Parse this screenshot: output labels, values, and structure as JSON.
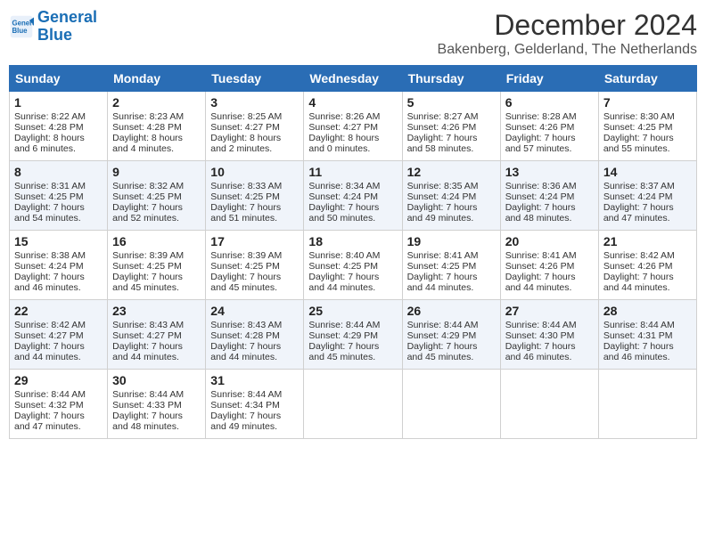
{
  "header": {
    "logo_line1": "General",
    "logo_line2": "Blue",
    "month": "December 2024",
    "location": "Bakenberg, Gelderland, The Netherlands"
  },
  "weekdays": [
    "Sunday",
    "Monday",
    "Tuesday",
    "Wednesday",
    "Thursday",
    "Friday",
    "Saturday"
  ],
  "weeks": [
    [
      {
        "day": "1",
        "sunrise": "Sunrise: 8:22 AM",
        "sunset": "Sunset: 4:28 PM",
        "daylight": "Daylight: 8 hours and 6 minutes."
      },
      {
        "day": "2",
        "sunrise": "Sunrise: 8:23 AM",
        "sunset": "Sunset: 4:28 PM",
        "daylight": "Daylight: 8 hours and 4 minutes."
      },
      {
        "day": "3",
        "sunrise": "Sunrise: 8:25 AM",
        "sunset": "Sunset: 4:27 PM",
        "daylight": "Daylight: 8 hours and 2 minutes."
      },
      {
        "day": "4",
        "sunrise": "Sunrise: 8:26 AM",
        "sunset": "Sunset: 4:27 PM",
        "daylight": "Daylight: 8 hours and 0 minutes."
      },
      {
        "day": "5",
        "sunrise": "Sunrise: 8:27 AM",
        "sunset": "Sunset: 4:26 PM",
        "daylight": "Daylight: 7 hours and 58 minutes."
      },
      {
        "day": "6",
        "sunrise": "Sunrise: 8:28 AM",
        "sunset": "Sunset: 4:26 PM",
        "daylight": "Daylight: 7 hours and 57 minutes."
      },
      {
        "day": "7",
        "sunrise": "Sunrise: 8:30 AM",
        "sunset": "Sunset: 4:25 PM",
        "daylight": "Daylight: 7 hours and 55 minutes."
      }
    ],
    [
      {
        "day": "8",
        "sunrise": "Sunrise: 8:31 AM",
        "sunset": "Sunset: 4:25 PM",
        "daylight": "Daylight: 7 hours and 54 minutes."
      },
      {
        "day": "9",
        "sunrise": "Sunrise: 8:32 AM",
        "sunset": "Sunset: 4:25 PM",
        "daylight": "Daylight: 7 hours and 52 minutes."
      },
      {
        "day": "10",
        "sunrise": "Sunrise: 8:33 AM",
        "sunset": "Sunset: 4:25 PM",
        "daylight": "Daylight: 7 hours and 51 minutes."
      },
      {
        "day": "11",
        "sunrise": "Sunrise: 8:34 AM",
        "sunset": "Sunset: 4:24 PM",
        "daylight": "Daylight: 7 hours and 50 minutes."
      },
      {
        "day": "12",
        "sunrise": "Sunrise: 8:35 AM",
        "sunset": "Sunset: 4:24 PM",
        "daylight": "Daylight: 7 hours and 49 minutes."
      },
      {
        "day": "13",
        "sunrise": "Sunrise: 8:36 AM",
        "sunset": "Sunset: 4:24 PM",
        "daylight": "Daylight: 7 hours and 48 minutes."
      },
      {
        "day": "14",
        "sunrise": "Sunrise: 8:37 AM",
        "sunset": "Sunset: 4:24 PM",
        "daylight": "Daylight: 7 hours and 47 minutes."
      }
    ],
    [
      {
        "day": "15",
        "sunrise": "Sunrise: 8:38 AM",
        "sunset": "Sunset: 4:24 PM",
        "daylight": "Daylight: 7 hours and 46 minutes."
      },
      {
        "day": "16",
        "sunrise": "Sunrise: 8:39 AM",
        "sunset": "Sunset: 4:25 PM",
        "daylight": "Daylight: 7 hours and 45 minutes."
      },
      {
        "day": "17",
        "sunrise": "Sunrise: 8:39 AM",
        "sunset": "Sunset: 4:25 PM",
        "daylight": "Daylight: 7 hours and 45 minutes."
      },
      {
        "day": "18",
        "sunrise": "Sunrise: 8:40 AM",
        "sunset": "Sunset: 4:25 PM",
        "daylight": "Daylight: 7 hours and 44 minutes."
      },
      {
        "day": "19",
        "sunrise": "Sunrise: 8:41 AM",
        "sunset": "Sunset: 4:25 PM",
        "daylight": "Daylight: 7 hours and 44 minutes."
      },
      {
        "day": "20",
        "sunrise": "Sunrise: 8:41 AM",
        "sunset": "Sunset: 4:26 PM",
        "daylight": "Daylight: 7 hours and 44 minutes."
      },
      {
        "day": "21",
        "sunrise": "Sunrise: 8:42 AM",
        "sunset": "Sunset: 4:26 PM",
        "daylight": "Daylight: 7 hours and 44 minutes."
      }
    ],
    [
      {
        "day": "22",
        "sunrise": "Sunrise: 8:42 AM",
        "sunset": "Sunset: 4:27 PM",
        "daylight": "Daylight: 7 hours and 44 minutes."
      },
      {
        "day": "23",
        "sunrise": "Sunrise: 8:43 AM",
        "sunset": "Sunset: 4:27 PM",
        "daylight": "Daylight: 7 hours and 44 minutes."
      },
      {
        "day": "24",
        "sunrise": "Sunrise: 8:43 AM",
        "sunset": "Sunset: 4:28 PM",
        "daylight": "Daylight: 7 hours and 44 minutes."
      },
      {
        "day": "25",
        "sunrise": "Sunrise: 8:44 AM",
        "sunset": "Sunset: 4:29 PM",
        "daylight": "Daylight: 7 hours and 45 minutes."
      },
      {
        "day": "26",
        "sunrise": "Sunrise: 8:44 AM",
        "sunset": "Sunset: 4:29 PM",
        "daylight": "Daylight: 7 hours and 45 minutes."
      },
      {
        "day": "27",
        "sunrise": "Sunrise: 8:44 AM",
        "sunset": "Sunset: 4:30 PM",
        "daylight": "Daylight: 7 hours and 46 minutes."
      },
      {
        "day": "28",
        "sunrise": "Sunrise: 8:44 AM",
        "sunset": "Sunset: 4:31 PM",
        "daylight": "Daylight: 7 hours and 46 minutes."
      }
    ],
    [
      {
        "day": "29",
        "sunrise": "Sunrise: 8:44 AM",
        "sunset": "Sunset: 4:32 PM",
        "daylight": "Daylight: 7 hours and 47 minutes."
      },
      {
        "day": "30",
        "sunrise": "Sunrise: 8:44 AM",
        "sunset": "Sunset: 4:33 PM",
        "daylight": "Daylight: 7 hours and 48 minutes."
      },
      {
        "day": "31",
        "sunrise": "Sunrise: 8:44 AM",
        "sunset": "Sunset: 4:34 PM",
        "daylight": "Daylight: 7 hours and 49 minutes."
      },
      null,
      null,
      null,
      null
    ]
  ]
}
